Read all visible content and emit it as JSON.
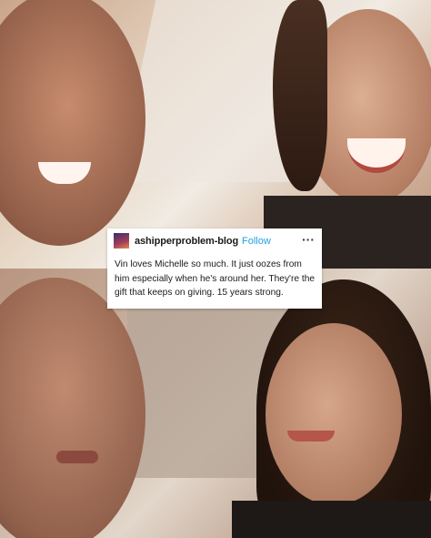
{
  "post": {
    "username": "ashipperproblem-blog",
    "follow_label": "Follow",
    "more_icon": "more-horizontal-icon",
    "text": "Vin loves Michelle so much. It just oozes from him especially when he's around her.   They're the gift that keeps on giving. 15 years strong."
  },
  "colors": {
    "follow": "#1f9fe5",
    "card": "#ffffff"
  }
}
